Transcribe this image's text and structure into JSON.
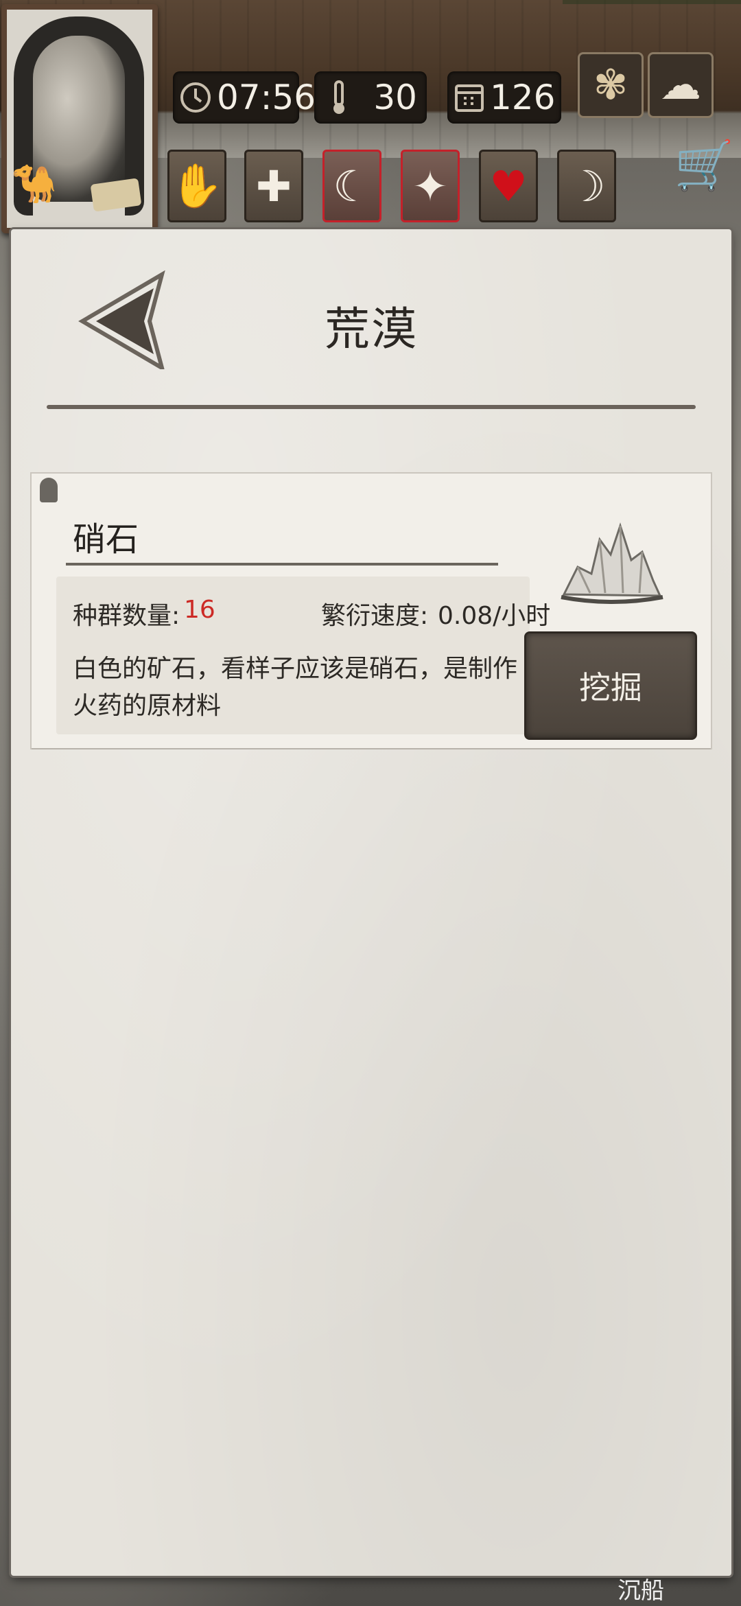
{
  "status_bar": {
    "time": "07:56",
    "temperature": "30",
    "day": "126",
    "icons": [
      "clock-icon",
      "thermometer-icon",
      "calendar-icon"
    ]
  },
  "top_buttons": [
    "leaf-icon",
    "cloud-icon"
  ],
  "status_icons": [
    {
      "name": "bandaged-hand-icon",
      "glyph": "✋",
      "alert": false
    },
    {
      "name": "health-cross-icon",
      "glyph": "✚",
      "alert": false
    },
    {
      "name": "stomach-icon",
      "glyph": "☾",
      "alert": true
    },
    {
      "name": "head-sparkle-icon",
      "glyph": "✦",
      "alert": true
    },
    {
      "name": "heart-icon",
      "glyph": "♥",
      "alert": false
    },
    {
      "name": "moon-star-icon",
      "glyph": "☽",
      "alert": false
    }
  ],
  "colors": {
    "alert_border": "#c4212a",
    "value_red": "#cc2a25",
    "paper": "#e6e3dc"
  },
  "panel": {
    "title": "荒漠",
    "resource": {
      "name": "硝石",
      "population_label": "种群数量:",
      "population_value": "16",
      "rate_label": "繁衍速度:",
      "rate_value": "0.08/小时",
      "description": "白色的矿石，看样子应该是硝石，是制作火药的原材料",
      "action_label": "挖掘",
      "image": "saltpeter-crystal-icon"
    }
  },
  "footer": {
    "bottom_text": "沉船"
  }
}
